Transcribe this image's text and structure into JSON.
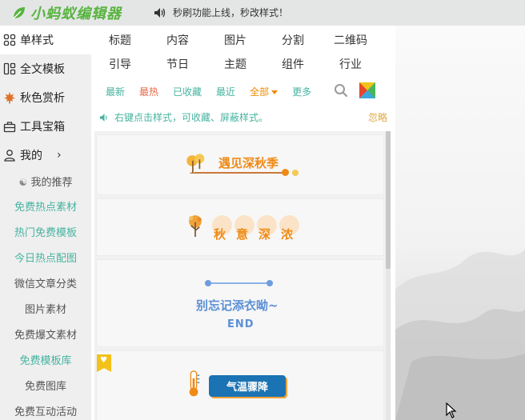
{
  "app": {
    "logo_text": "小蚂蚁编辑器",
    "notice": "秒刷功能上线，秒改样式！"
  },
  "sidebar": {
    "items": [
      {
        "label": "单样式",
        "icon": "grid-icon",
        "active": true
      },
      {
        "label": "全文模板",
        "icon": "template-icon"
      },
      {
        "label": "秋色赏析",
        "icon": "maple-leaf-icon"
      },
      {
        "label": "工具宝箱",
        "icon": "toolbox-icon"
      },
      {
        "label": "我的",
        "icon": "user-icon"
      }
    ],
    "sub_items": [
      "我的推荐",
      "免费热点素材",
      "热门免费模板",
      "今日热点配图",
      "微信文章分类",
      "图片素材",
      "免费爆文素材",
      "免费模板库",
      "免费图库",
      "免费互动活动"
    ]
  },
  "categories": {
    "row1": [
      "标题",
      "内容",
      "图片",
      "分割",
      "二维码"
    ],
    "row2": [
      "引导",
      "节日",
      "主题",
      "组件",
      "行业"
    ]
  },
  "filters": [
    "最新",
    "最热",
    "已收藏",
    "最近",
    "全部",
    "更多"
  ],
  "tip": {
    "text": "右键点击样式，可收藏、屏蔽样式。",
    "ignore": "忽略"
  },
  "styles": {
    "card1": "遇见深秋季",
    "card2": [
      "秋",
      "意",
      "深",
      "浓"
    ],
    "card3_title": "别忘记添衣呦~",
    "card3_end": "END",
    "card4": "气温骤降"
  },
  "colors": {
    "accent_green": "#46b3a0",
    "hot_red": "#e46a4a",
    "orange": "#f08a00",
    "logo_green": "#58b43e"
  }
}
